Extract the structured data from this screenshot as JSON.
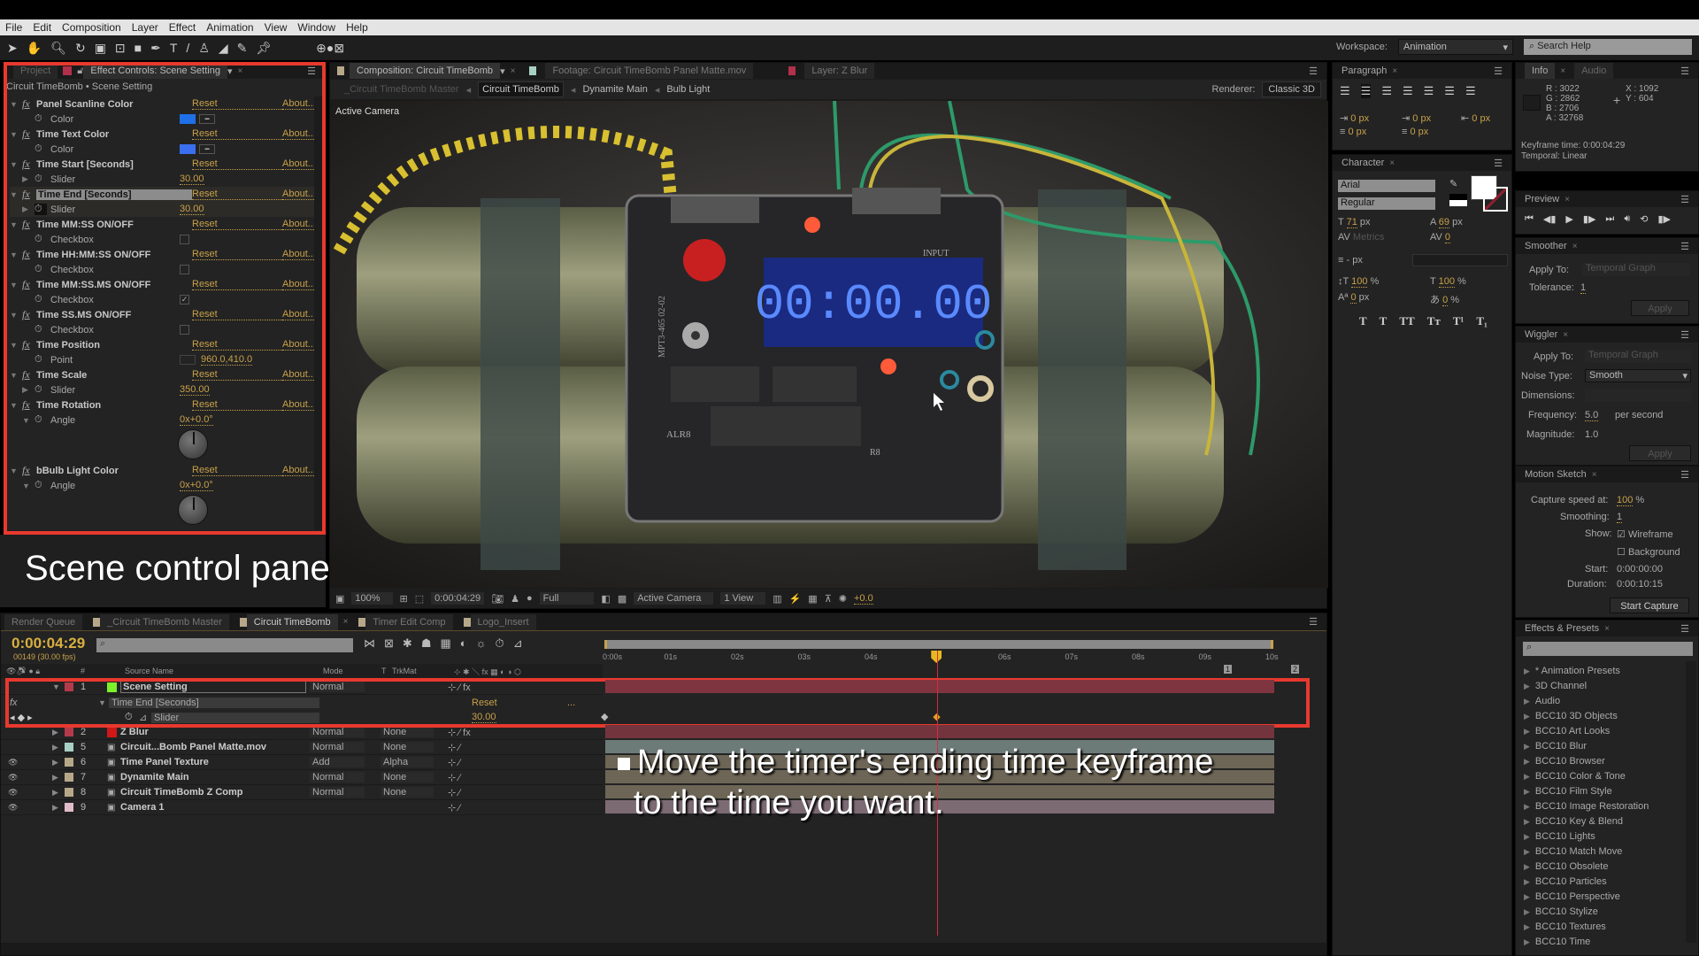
{
  "menu": [
    "File",
    "Edit",
    "Composition",
    "Layer",
    "Effect",
    "Animation",
    "View",
    "Window",
    "Help"
  ],
  "workspace": {
    "label": "Workspace:",
    "value": "Animation",
    "search_placeholder": "Search Help"
  },
  "effect_controls": {
    "tabs": {
      "project": "Project",
      "active": "Effect Controls: Scene Setting"
    },
    "breadcrumb": "Circuit TimeBomb • Scene Setting",
    "reset": "Reset",
    "about": "About...",
    "rows": [
      {
        "type": "fx",
        "name": "Panel Scanline Color"
      },
      {
        "type": "color",
        "name": "Color",
        "color": "#1e6fe8"
      },
      {
        "type": "fx",
        "name": "Time Text Color"
      },
      {
        "type": "color",
        "name": "Color",
        "color": "#3a6ff0"
      },
      {
        "type": "fx",
        "name": "Time Start [Seconds]"
      },
      {
        "type": "value",
        "name": "Slider",
        "value": "30.00",
        "twirl": true
      },
      {
        "type": "fx",
        "name": "Time End [Seconds]",
        "selected": true
      },
      {
        "type": "value",
        "name": "Slider",
        "value": "30.00",
        "twirl": true,
        "selected": true
      },
      {
        "type": "fx",
        "name": "Time MM:SS ON/OFF"
      },
      {
        "type": "check",
        "name": "Checkbox",
        "checked": false
      },
      {
        "type": "fx",
        "name": "Time HH:MM:SS ON/OFF"
      },
      {
        "type": "check",
        "name": "Checkbox",
        "checked": false
      },
      {
        "type": "fx",
        "name": "Time MM:SS.MS ON/OFF"
      },
      {
        "type": "check",
        "name": "Checkbox",
        "checked": true
      },
      {
        "type": "fx",
        "name": "Time SS.MS ON/OFF"
      },
      {
        "type": "check",
        "name": "Checkbox",
        "checked": false
      },
      {
        "type": "fx",
        "name": "Time Position"
      },
      {
        "type": "value",
        "name": "Point",
        "value": "960.0,410.0",
        "point": true
      },
      {
        "type": "fx",
        "name": "Time Scale"
      },
      {
        "type": "value",
        "name": "Slider",
        "value": "350.00",
        "twirl": true
      },
      {
        "type": "fx",
        "name": "Time Rotation"
      },
      {
        "type": "angle",
        "name": "Angle",
        "value": "0x+0.0°"
      },
      {
        "type": "fx",
        "name": "bBulb Light Color"
      },
      {
        "type": "angle",
        "name": "Angle",
        "value": "0x+0.0°"
      }
    ]
  },
  "caption_panel": "Scene control panel",
  "viewer": {
    "tabs": [
      "Composition: Circuit TimeBomb",
      "Footage: Circuit TimeBomb Panel Matte.mov",
      "Layer: Z Blur"
    ],
    "breadcrumbs": [
      "_Circuit TimeBomb Master",
      "Circuit TimeBomb",
      "Dynamite Main",
      "Bulb Light"
    ],
    "renderer_label": "Renderer:",
    "renderer": "Classic 3D",
    "camera_label": "Active Camera",
    "lcd": "00:00.00",
    "board_labels": {
      "input": "INPUT",
      "model": "MPT3-465 02-02",
      "alr": "ALR8",
      "r": "R8"
    },
    "toolbar": {
      "zoom": "100%",
      "time": "0:00:04:29",
      "resolution": "Full",
      "camera": "Active Camera",
      "views": "1 View",
      "exposure": "+0.0"
    }
  },
  "timeline": {
    "tabs": [
      "Render Queue",
      "_Circuit TimeBomb Master",
      "Circuit TimeBomb",
      "Timer Edit Comp",
      "Logo_Insert"
    ],
    "active_tab": 2,
    "current_time": "0:00:04:29",
    "frame_info": "00149 (30.00 fps)",
    "columns": {
      "num": "#",
      "source": "Source Name",
      "mode": "Mode",
      "t": "T",
      "trkmat": "TrkMat"
    },
    "ruler": [
      "0:00s",
      "01s",
      "02s",
      "03s",
      "04s",
      "05s",
      "06s",
      "07s",
      "08s",
      "09s",
      "10s"
    ],
    "playhead_seconds": 4.97,
    "duration_seconds": 10,
    "layers": [
      {
        "num": "1",
        "name": "Scene Setting",
        "label": "#b33a4a",
        "swatch": "#7cf02a",
        "mode": "Normal",
        "trkmat": "",
        "bar": "#7e3540",
        "open": true
      },
      {
        "num": "2",
        "name": "Z Blur",
        "label": "#b33a4a",
        "swatch": "#d01818",
        "mode": "Normal",
        "trkmat": "None",
        "bar": "#74343e"
      },
      {
        "num": "5",
        "name": "Circuit...Bomb Panel Matte.mov",
        "label": "#a8d0c4",
        "mode": "Normal",
        "trkmat": "None",
        "bar": "#6c7a78"
      },
      {
        "num": "6",
        "name": "Time Panel Texture",
        "label": "#b8a88a",
        "mode": "Add",
        "trkmat": "Alpha",
        "bar": "#6d6556"
      },
      {
        "num": "7",
        "name": "Dynamite Main",
        "label": "#b8a88a",
        "mode": "Normal",
        "trkmat": "None",
        "bar": "#6d6556"
      },
      {
        "num": "8",
        "name": "Circuit TimeBomb Z Comp",
        "label": "#b8a88a",
        "mode": "Normal",
        "trkmat": "None",
        "bar": "#6d6556"
      },
      {
        "num": "9",
        "name": "Camera 1",
        "label": "#e0bccb",
        "mode": "",
        "trkmat": "",
        "bar": "#7d6b74"
      }
    ],
    "property": {
      "group": "Time End [Seconds]",
      "name": "Slider",
      "reset": "Reset",
      "value": "30.00",
      "dots": "..."
    },
    "keyframes_seconds": [
      0,
      4.97
    ],
    "markers": [
      "1",
      "2"
    ],
    "caption_lines": [
      "Move the timer's ending time keyframe",
      "to the time you want."
    ]
  },
  "paragraph": {
    "title": "Paragraph",
    "fields": [
      "0 px",
      "0 px",
      "0 px",
      "0 px",
      "0 px"
    ]
  },
  "character": {
    "title": "Character",
    "font": "Arial",
    "style": "Regular",
    "size": "71",
    "size_unit": "px",
    "leading": "69",
    "leading_unit": "px",
    "kerning": "Metrics",
    "tracking": "0",
    "stroke": "- px",
    "vscale": "100",
    "vscale_unit": "%",
    "hscale": "100",
    "hscale_unit": "%",
    "baseline": "0",
    "baseline_unit": "px",
    "tsume": "0",
    "tsume_unit": "%",
    "styles": [
      "T",
      "T",
      "TT",
      "Tт",
      "T¹",
      "T₁"
    ]
  },
  "info": {
    "tabs": [
      "Info",
      "Audio"
    ],
    "r": "R : 3022",
    "g": "G : 2862",
    "b": "B : 2706",
    "a": "A : 32768",
    "x": "X : 1092",
    "y": "Y : 604",
    "kf_time": "Keyframe time: 0:00:04:29",
    "temporal": "Temporal: Linear"
  },
  "preview": {
    "title": "Preview"
  },
  "smoother": {
    "title": "Smoother",
    "apply_to_label": "Apply To:",
    "apply_to": "Temporal Graph",
    "tolerance_label": "Tolerance:",
    "tolerance": "1",
    "apply": "Apply"
  },
  "wiggler": {
    "title": "Wiggler",
    "apply_to_label": "Apply To:",
    "apply_to": "Temporal Graph",
    "noise_label": "Noise Type:",
    "noise": "Smooth",
    "dims_label": "Dimensions:",
    "freq_label": "Frequency:",
    "freq": "5.0",
    "freq_unit": "per second",
    "mag_label": "Magnitude:",
    "mag": "1.0",
    "apply": "Apply"
  },
  "motion_sketch": {
    "title": "Motion Sketch",
    "speed_label": "Capture speed at:",
    "speed": "100",
    "speed_unit": "%",
    "smooth_label": "Smoothing:",
    "smooth": "1",
    "show_label": "Show:",
    "wireframe": "Wireframe",
    "wireframe_checked": true,
    "background": "Background",
    "background_checked": false,
    "start_label": "Start:",
    "start": "0:00:00:00",
    "duration_label": "Duration:",
    "duration": "0:00:10:15",
    "capture": "Start Capture"
  },
  "effects_presets": {
    "title": "Effects & Presets",
    "items": [
      "* Animation Presets",
      "3D Channel",
      "Audio",
      "BCC10 3D Objects",
      "BCC10 Art Looks",
      "BCC10 Blur",
      "BCC10 Browser",
      "BCC10 Color & Tone",
      "BCC10 Film Style",
      "BCC10 Image Restoration",
      "BCC10 Key & Blend",
      "BCC10 Lights",
      "BCC10 Match Move",
      "BCC10 Obsolete",
      "BCC10 Particles",
      "BCC10 Perspective",
      "BCC10 Stylize",
      "BCC10 Textures",
      "BCC10 Time"
    ]
  },
  "colors": {
    "highlight": "#e8392f",
    "accent": "#c9a14a",
    "playhead": "#d0303a"
  }
}
